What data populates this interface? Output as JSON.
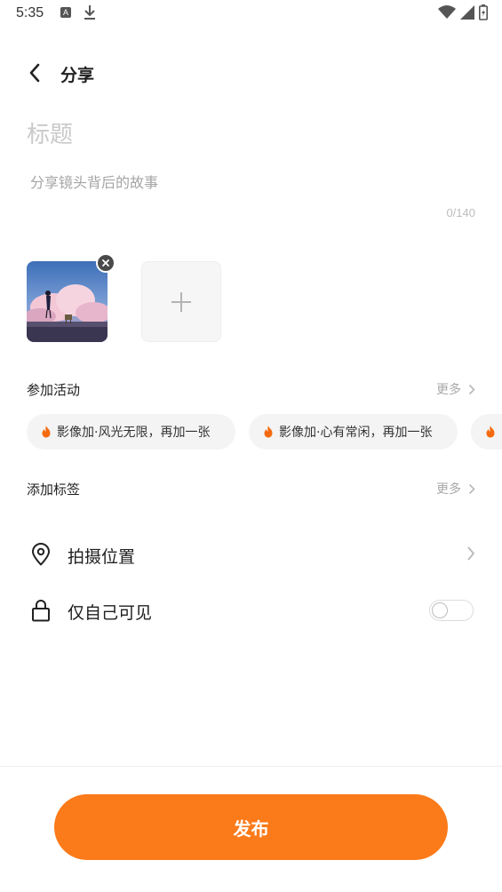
{
  "status_bar": {
    "time": "5:35",
    "icons": [
      "a-icon",
      "download-icon",
      "wifi-icon",
      "signal-icon",
      "battery-icon"
    ]
  },
  "header": {
    "back_icon": "chevron-left-icon",
    "title": "分享"
  },
  "form": {
    "title_placeholder": "标题",
    "title_value": "",
    "story_placeholder": "分享镜头背后的故事",
    "story_value": "",
    "counter": "0/140"
  },
  "photos": {
    "remove_icon": "close-icon",
    "add_icon": "plus-icon"
  },
  "activities": {
    "label": "参加活动",
    "more": "更多",
    "chips": [
      {
        "label": "影像加·风光无限，再加一张",
        "icon": "flame-icon"
      },
      {
        "label": "影像加·心有常闲，再加一张",
        "icon": "flame-icon"
      },
      {
        "label": "",
        "icon": "flame-icon"
      }
    ]
  },
  "tags": {
    "label": "添加标签",
    "more": "更多"
  },
  "location": {
    "label": "拍摄位置",
    "icon": "location-pin-icon"
  },
  "privacy": {
    "label": "仅自己可见",
    "icon": "lock-icon",
    "enabled": false
  },
  "publish": {
    "label": "发布"
  },
  "colors": {
    "accent": "#fb7a19",
    "flame": "#f56a0f",
    "muted_text": "#a8a8a8"
  }
}
